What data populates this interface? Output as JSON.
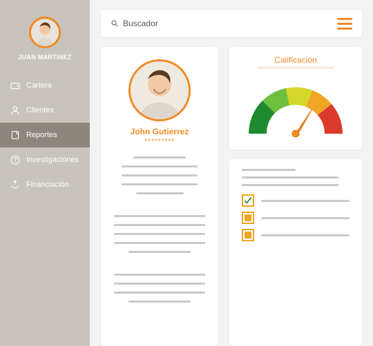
{
  "user": {
    "name": "JUAN MARTINEZ"
  },
  "sidebar": {
    "items": [
      {
        "label": "Cartera",
        "icon": "wallet-icon",
        "active": false
      },
      {
        "label": "Clientes",
        "icon": "person-icon",
        "active": false
      },
      {
        "label": "Reportes",
        "icon": "reports-icon",
        "active": true
      },
      {
        "label": "Investigaciones",
        "icon": "help-icon",
        "active": false
      },
      {
        "label": "Financiación",
        "icon": "finance-icon",
        "active": false
      }
    ]
  },
  "search": {
    "placeholder": "Buscador"
  },
  "client": {
    "name": "John Gutierrez",
    "stars": "*********"
  },
  "score": {
    "title": "Calificación"
  },
  "colors": {
    "accent": "#f08a24"
  }
}
